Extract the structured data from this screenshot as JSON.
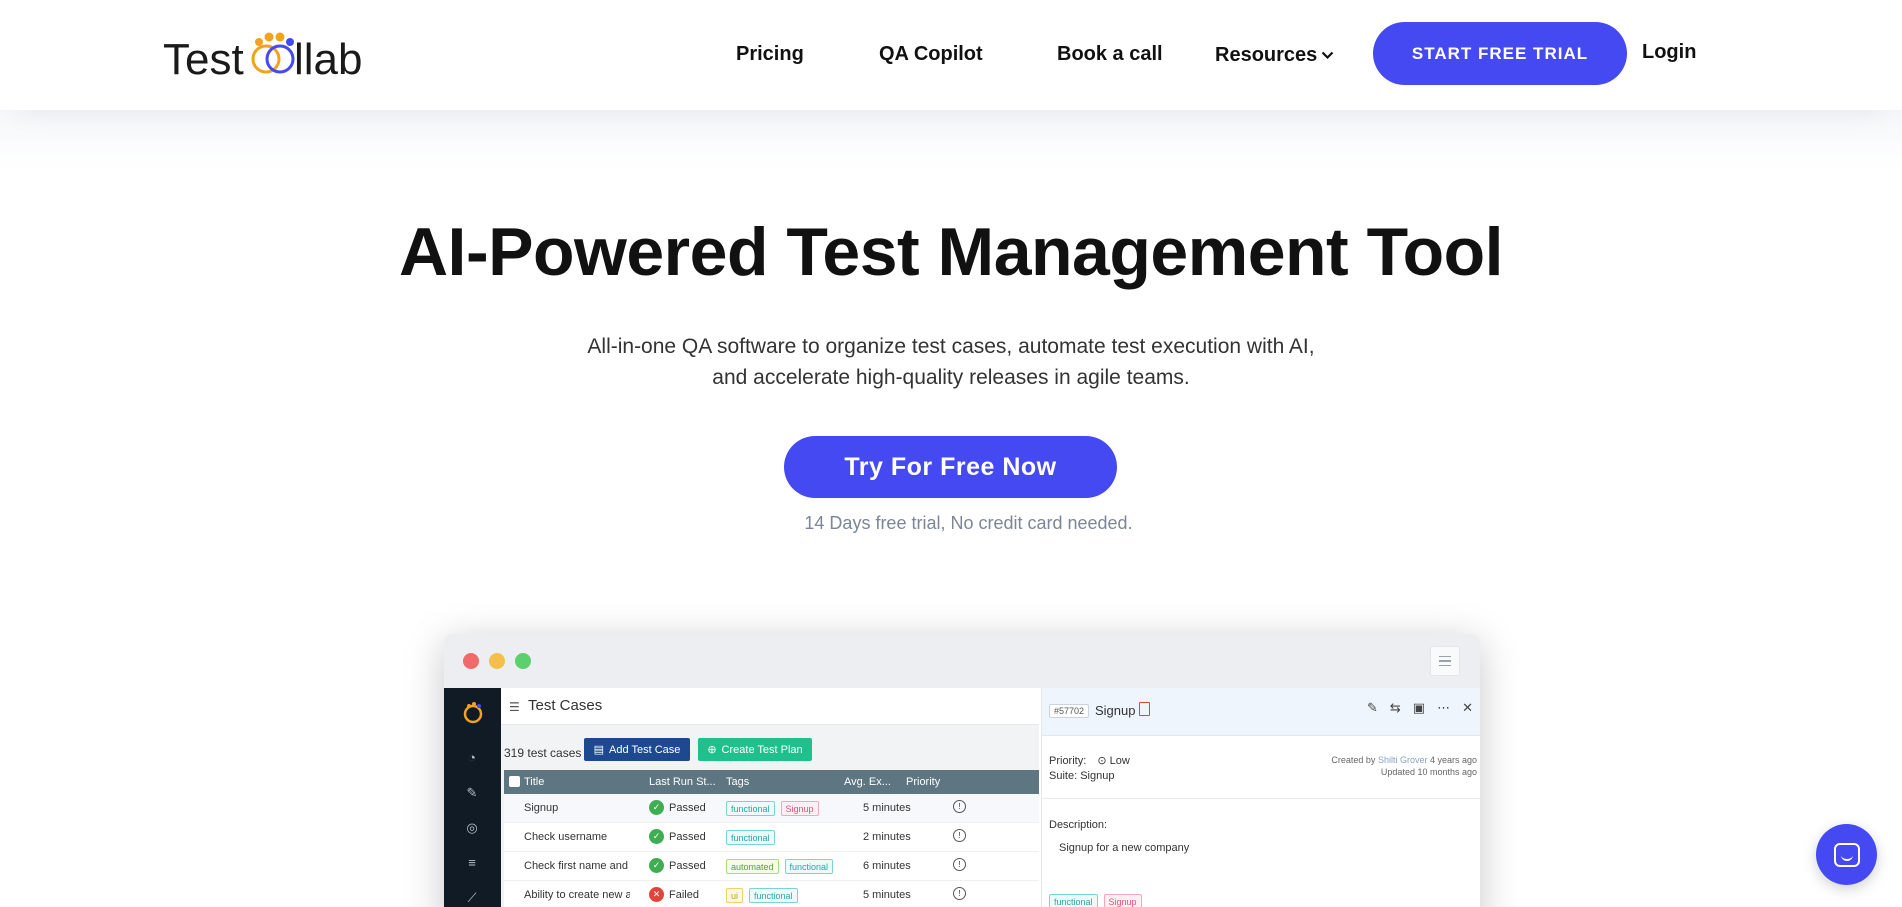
{
  "brand": {
    "name": "Testcollab",
    "logo_text_left": "Test",
    "logo_text_right": "llab",
    "color": "#4549f2"
  },
  "nav": {
    "pricing": "Pricing",
    "qa_copilot": "QA Copilot",
    "book_call": "Book a call",
    "resources": "Resources",
    "trial_button": "START FREE TRIAL",
    "login": "Login"
  },
  "hero": {
    "title": "AI-Powered Test Management Tool",
    "subtitle_line1": "All-in-one QA software to organize test cases, automate test execution with AI,",
    "subtitle_line2": "and accelerate high-quality releases in agile teams.",
    "cta": "Try For Free Now",
    "note": "14 Days free trial, No credit card needed."
  },
  "app": {
    "page_title": "Test Cases",
    "count": "319 test cases",
    "add_button": "Add Test Case",
    "plan_button": "Create Test Plan",
    "columns": [
      "Title",
      "Last Run St...",
      "Tags",
      "Avg. Ex...",
      "Priority"
    ],
    "rows": [
      {
        "title": "Signup",
        "status": "Passed",
        "status_kind": "pass",
        "tags": [
          {
            "text": "functional",
            "kind": "teal"
          },
          {
            "text": "Signup",
            "kind": "pink"
          }
        ],
        "avg": "5 minutes"
      },
      {
        "title": "Check username",
        "status": "Passed",
        "status_kind": "pass",
        "tags": [
          {
            "text": "functional",
            "kind": "teal"
          }
        ],
        "avg": "2 minutes"
      },
      {
        "title": "Check first name and last name",
        "status": "Passed",
        "status_kind": "pass",
        "tags": [
          {
            "text": "automated",
            "kind": "green"
          },
          {
            "text": "functional",
            "kind": "teal"
          }
        ],
        "avg": "6 minutes"
      },
      {
        "title": "Ability to create new account",
        "status": "Failed",
        "status_kind": "fail",
        "tags": [
          {
            "text": "ui",
            "kind": "yellow"
          },
          {
            "text": "functional",
            "kind": "teal"
          }
        ],
        "avg": "5 minutes"
      }
    ],
    "detail": {
      "id": "#57702",
      "title": "Signup",
      "priority_label": "Priority:",
      "priority": "Low",
      "suite_label": "Suite:",
      "suite": "Signup",
      "created_prefix": "Created by",
      "created_by": "Shilti Grover",
      "created_ago": "4 years ago",
      "updated": "Updated 10 months ago",
      "description_label": "Description:",
      "description": "Signup for a new company",
      "tags": [
        {
          "text": "functional",
          "kind": "teal"
        },
        {
          "text": "Signup",
          "kind": "pink"
        }
      ]
    }
  }
}
